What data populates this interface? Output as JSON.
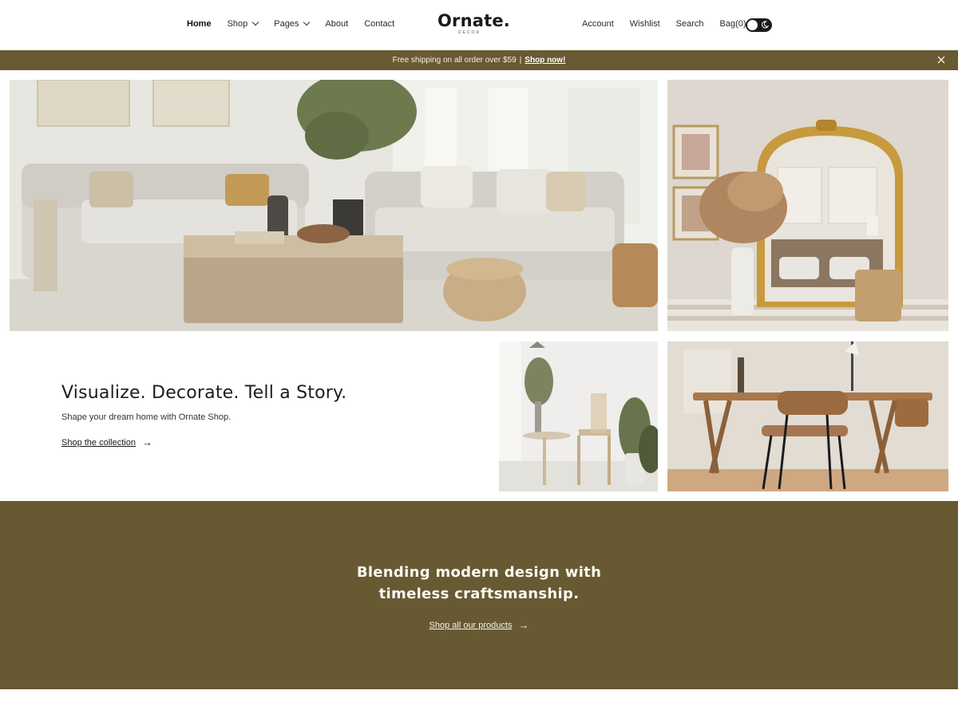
{
  "header": {
    "nav_left": [
      {
        "label": "Home",
        "active": true,
        "dropdown": false
      },
      {
        "label": "Shop",
        "active": false,
        "dropdown": true
      },
      {
        "label": "Pages",
        "active": false,
        "dropdown": true
      },
      {
        "label": "About",
        "active": false,
        "dropdown": false
      },
      {
        "label": "Contact",
        "active": false,
        "dropdown": false
      }
    ],
    "logo": {
      "main": "Ornate.",
      "sub": "DECOR"
    },
    "nav_right": [
      {
        "label": "Account"
      },
      {
        "label": "Wishlist"
      },
      {
        "label": "Search"
      },
      {
        "label": "Bag(0)"
      }
    ],
    "theme_toggle": {
      "icon": "moon-icon",
      "state": "light"
    }
  },
  "announcement": {
    "text": "Free shipping on all order over $59",
    "separator": "|",
    "link": "Shop now!",
    "close_icon": "close-icon"
  },
  "hero": {
    "title": "Visualize. Decorate. Tell a Story.",
    "subtitle": "Shape your dream home with Ornate Shop.",
    "cta": "Shop the collection",
    "cta_icon": "arrow-right-icon"
  },
  "band": {
    "title_line1": "Blending modern design with",
    "title_line2": "timeless craftsmanship.",
    "cta": "Shop all our products",
    "cta_icon": "arrow-right-icon"
  },
  "colors": {
    "olive": "#685a32",
    "text": "#1f1f1f",
    "background": "#ffffff"
  }
}
